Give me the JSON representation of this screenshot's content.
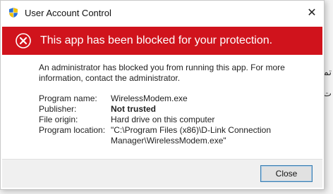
{
  "background": {
    "line1": "تما",
    "line2": "ت ز"
  },
  "dialog": {
    "title": "User Account Control",
    "close_glyph": "✕",
    "banner": {
      "text": "This app has been blocked for your protection.",
      "color": "#d0131c"
    },
    "message": "An administrator has blocked you from running this app. For more information, contact the administrator.",
    "details": [
      {
        "label": "Program name:",
        "value": "WirelessModem.exe",
        "bold": false
      },
      {
        "label": "Publisher:",
        "value": "Not trusted",
        "bold": true
      },
      {
        "label": "File origin:",
        "value": "Hard drive on this computer",
        "bold": false
      },
      {
        "label": "Program location:",
        "value": "\"C:\\Program Files (x86)\\D-Link Connection Manager\\WirelessModem.exe\"",
        "bold": false
      }
    ],
    "buttons": {
      "close_label": "Close"
    }
  },
  "icons": {
    "title": "uac-shield-icon",
    "banner": "blocked-x-icon"
  }
}
